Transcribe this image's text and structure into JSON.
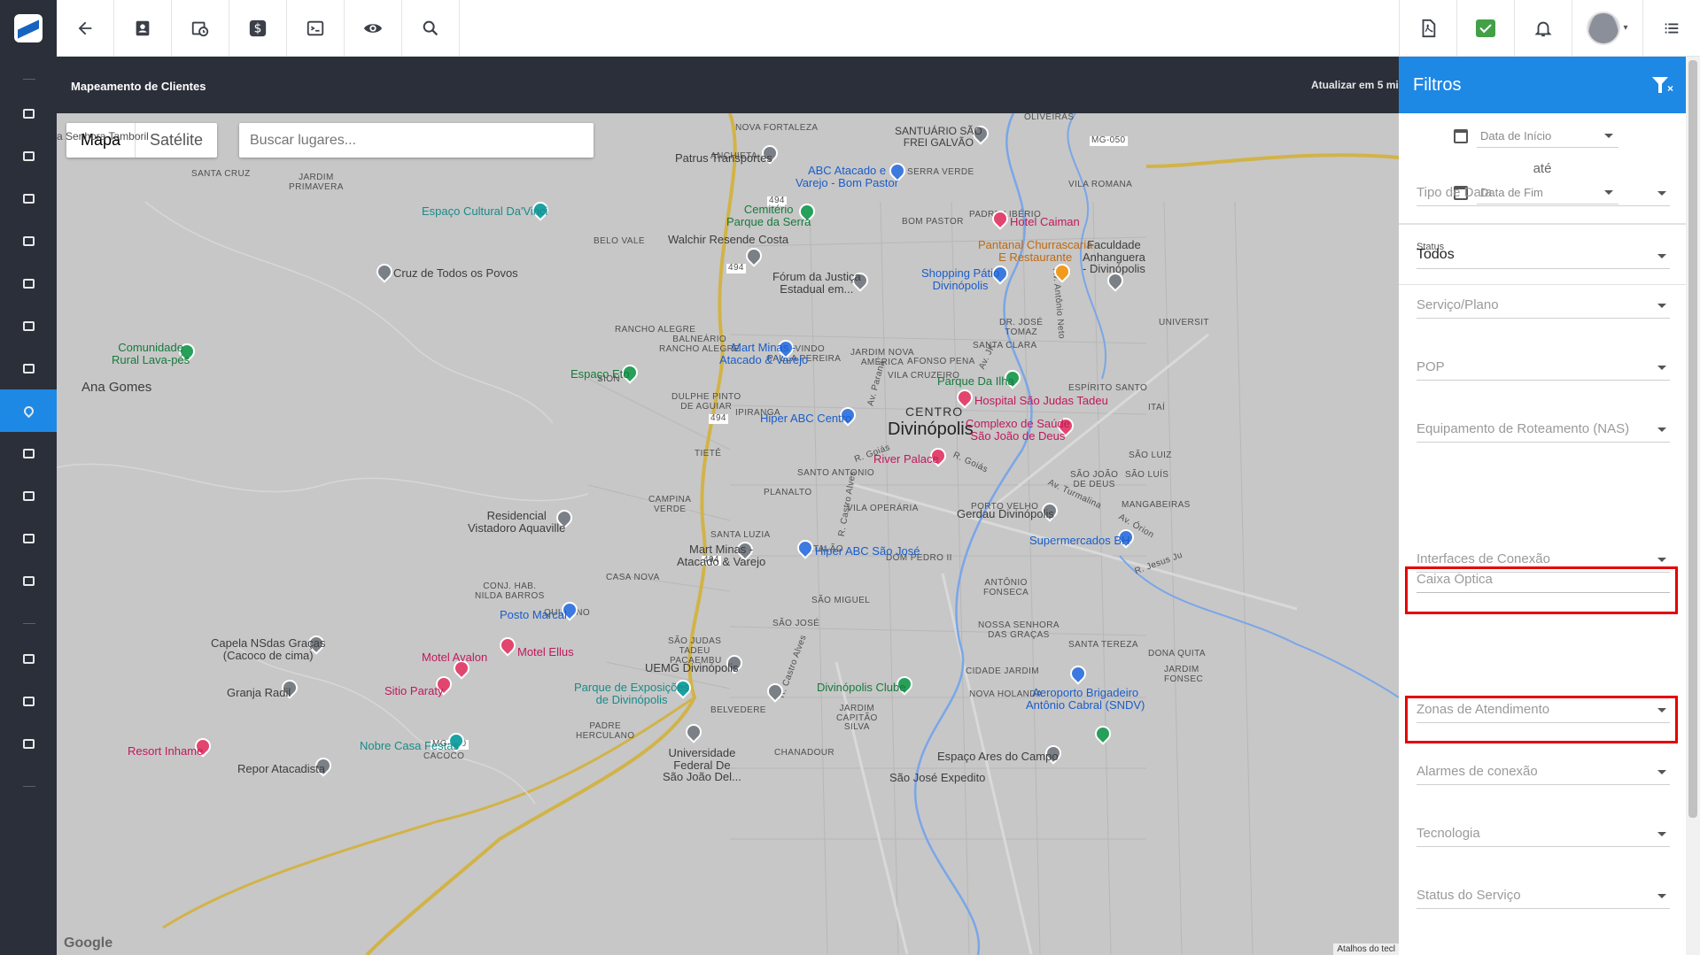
{
  "header": {
    "title": "Mapeamento de Clientes",
    "refresh_text": "Atualizar em 5 mi"
  },
  "map": {
    "toggle": {
      "map": "Mapa",
      "satellite": "Satélite"
    },
    "search_placeholder": "Buscar lugares...",
    "labels": {
      "ana_gomes": "Ana Gomes",
      "divinopolis": "Divinópolis",
      "centro": "CENTRO",
      "nova_fortaleza": "NOVA FORTALEZA",
      "anchieta": "ANCHIETA",
      "santa_cruz": "SANTA CRUZ",
      "jardim_primavera": "JARDIM\nPRIMAVERA",
      "belo_vale": "BELO VALE",
      "rancho_alegre": "RANCHO ALEGRE",
      "balneario": "BALNEÁRIO\nRANCHO ALEGRE",
      "levindo": "LEVINDO\nPAULA PEREIRA",
      "sion": "SION",
      "dulphe": "DULPHE PINTO\nDE AGUIAR",
      "ipiranga": "IPIRANGA",
      "tiete": "TIETÊ",
      "planalto": "PLANALTO",
      "campina_verde": "CAMPINA\nVERDE",
      "santa_luzia": "SANTA LUZIA",
      "casa_nova": "CASA NOVA",
      "conj_hab": "CONJ. HAB.\nNILDA BARROS",
      "quintino": "QUINTINO",
      "sao_judas": "SÃO JUDAS\nTADEU",
      "pacaembu": "PACAEMBU",
      "padre_herculano": "PADRE\nHERCULANO",
      "belvedere": "BELVEDERE",
      "sao_jose": "SÃO JOSÉ",
      "sao_miguel": "SÃO MIGUEL",
      "catalao": "CATALÃO",
      "santo_antonio": "SANTO ANTONIO",
      "vila_operaria": "VILA OPERÁRIA",
      "jardim_nova_america": "JARDIM NOVA\nAMÉRICA",
      "vila_cruzeiro": "VILA CRUZEIRO",
      "afonso_pena": "AFONSO PENA",
      "santa_clara": "SANTA CLARA",
      "bom_pastor": "BOM PASTOR",
      "padre_liberio": "PADRE LIBÉRIO",
      "vila_romana": "VILA ROMANA",
      "oliveiras": "OLIVEIRAS",
      "serra_verde": "SERRA VERDE",
      "dr_jose_tomaz": "DR. JOSÉ\nTOMAZ",
      "espirito_santo": "ESPÍRITO SANTO",
      "itai": "ITAÍ",
      "sao_luiz": "SÃO LUIZ",
      "sao_joao_de_deus": "SÃO JOÃO\nDE DEUS",
      "sao_luis": "SÃO LUÍS",
      "porto_velho": "PORTO VELHO",
      "mangabeiras": "MANGABEIRAS",
      "dom_pedro": "DOM PEDRO II",
      "antonio_fonseca": "ANTÔNIO\nFONSECA",
      "nossa_senhora": "NOSSA SENHORA\nDAS GRAÇAS",
      "santa_tereza": "SANTA TEREZA",
      "dona_quita": "DONA QUITA",
      "jardim_fonseca": "JARDIM\nFONSEC",
      "cidade_jardim": "CIDADE JARDIM",
      "nova_holanda": "NOVA HOLANDA",
      "jardim_capitao": "JARDIM\nCAPITÃO\nSILVA",
      "chanadour": "CHANADOUR",
      "universit": "UNIVERSIT",
      "senhora_tamboril": "a Senhora\nTamboril",
      "cacoco": "CACOCO",
      "sao_jose_expedito": "São José Expedito"
    },
    "places": {
      "espaco_cultural": "Espaço Cultural Da'Vinci",
      "cruz_todos": "Cruz de Todos os Povos",
      "comunidade": "Comunidade\nRural Lava-pés",
      "patrus": "Patrus Transportes",
      "abc_atacado": "ABC Atacado e\nVarejo - Bom Pastor",
      "santuario": "SANTUÁRIO SÃO\nFREI GALVÃO",
      "cemiterio": "Cemitério\nParque da Serra",
      "walchir": "Walchir Resende Costa",
      "hotel_caiman": "Hotel Caiman",
      "pantanal": "Pantanal Churrascaria\nE Restaurante",
      "faculdade": "Faculdade\nAnhanguera\n- Divinópolis",
      "forum": "Fórum da Justiça\nEstadual em...",
      "shopping": "Shopping Pátio\nDivinópolis",
      "mart_minas_1": "Mart Minas -\nAtacado & Varejo",
      "espaco_eto": "Espaço Eto",
      "parque_ilha": "Parque Da Ilha",
      "hospital_sjt": "Hospital São Judas Tadeu",
      "hiper_abc_centro": "Hiper ABC Centro",
      "complexo": "Complexo de Saúde\nSão João de Deus",
      "river_palace": "River Palace",
      "gerdau": "Gerdau Divinópolis",
      "supermercados": "Supermercados BH",
      "residencial": "Residencial\nVistadoro Aquaville",
      "mart_minas_2": "Mart Minas -\nAtacado & Varejo",
      "hiper_abc_sj": "Hiper ABC São José",
      "posto_marcal": "Posto Marcal",
      "capela": "Capela NSdas Graças\n(Cacoco de cima)",
      "motel_avalon": "Motel Avalon",
      "motel_ellus": "Motel Ellus",
      "uemg": "UEMG Divinópolis",
      "granja": "Granja Radil",
      "sitio_paraty": "Sitio Paraty",
      "parque_exp": "Parque de Exposições\nde Divinópolis",
      "div_clube": "Divinópolis Clube",
      "aeroporto": "Aeroporto Brigadeiro\nAntônio Cabral (SNDV)",
      "resort": "Resort Inhame",
      "nobre_casa": "Nobre Casa Festas",
      "univ_federal": "Universidade\nFederal De\nSão João Del...",
      "repor": "Repor Atacadista",
      "espaco_ares": "Espaço Ares do Campo"
    },
    "roads": [
      "494",
      "494",
      "494",
      "494",
      "MG-050",
      "MG-050"
    ],
    "street_labels": {
      "av_parana": "Av. Paraná",
      "r_goias": "R. Goiás",
      "r_goias_2": "R. Goiás",
      "av_jk": "Av. JK",
      "av_antonio_neto": "Av. Antônio Neto",
      "r_castro_alves": "R. Castro Alves",
      "r_castro_alves_2": "R. Castro Alves",
      "av_turmalina": "Av. Turmalina",
      "av_orion": "Av. Órion",
      "r_jesus_ju": "R. Jesus Ju"
    },
    "google_logo": "Google",
    "attribution": "Atalhos do tecl"
  },
  "filters": {
    "title": "Filtros",
    "date_start": "Data de Início",
    "date_sep": "até",
    "date_end": "Data de Fim",
    "fields": [
      {
        "label": "",
        "value": "Tipo de Data",
        "placeholder": true
      },
      {
        "label": "Status",
        "value": "Todos",
        "placeholder": false
      },
      {
        "label": "",
        "value": "Serviço/Plano",
        "placeholder": true
      },
      {
        "label": "",
        "value": "POP",
        "placeholder": true
      },
      {
        "label": "",
        "value": "Equipamento de Roteamento (NAS)",
        "placeholder": true
      },
      {
        "label": "",
        "value": "Caixa Óptica",
        "placeholder": true
      },
      {
        "label": "",
        "value": "Interfaces de Conexão",
        "placeholder": true
      },
      {
        "label": "",
        "value": "Zonas de Atendimento",
        "placeholder": true
      },
      {
        "label": "",
        "value": "Alarmes de conexão",
        "placeholder": true
      },
      {
        "label": "",
        "value": "Tecnologia",
        "placeholder": true
      },
      {
        "label": "",
        "value": "Status do Serviço",
        "placeholder": true
      }
    ]
  },
  "colors": {
    "sidebar": "#2b2f3a",
    "accent": "#1e88e5",
    "highlight": "#e60000",
    "map_bg": "#c7c7c7"
  },
  "icons": {
    "topbar_left": [
      "back-arrow-icon",
      "contact-card-icon",
      "calendar-clock-icon",
      "dollar-icon",
      "terminal-icon",
      "eye-icon",
      "search-icon"
    ],
    "topbar_right": [
      "pdf-icon",
      "chat-check-icon",
      "bell-icon",
      "avatar",
      "list-icon"
    ]
  }
}
